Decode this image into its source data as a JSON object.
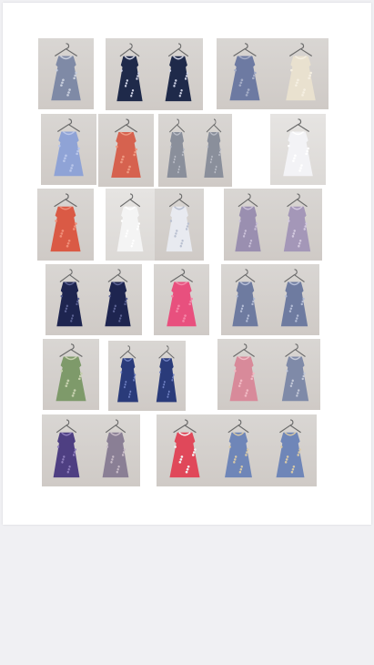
{
  "page": {
    "background": "#f0f0f3",
    "sheet_color": "#ffffff"
  },
  "photos": [
    {
      "name": "photo-gingham-dress",
      "colors": [
        "#7f8aa6",
        "#c9cfdd"
      ]
    },
    {
      "name": "photo-check-pinafore-dress-front",
      "colors": [
        "#1f2a4a",
        "#d0d4e6"
      ]
    },
    {
      "name": "photo-check-pinafore-dress-back",
      "colors": [
        "#1f2a4a",
        "#cfd3e6"
      ]
    },
    {
      "name": "photo-blue-pinafore",
      "colors": [
        "#6d7aa2",
        "#a4acc6"
      ]
    },
    {
      "name": "photo-cream-pinafore",
      "colors": [
        "#e9e1cf",
        "#f5efe2"
      ]
    },
    {
      "name": "photo-light-blue-dress",
      "colors": [
        "#8fa3d6",
        "#b9c6ea"
      ]
    },
    {
      "name": "photo-red-floral-dress",
      "colors": [
        "#d6624f",
        "#ee9a82"
      ]
    },
    {
      "name": "photo-floral-romper-front",
      "colors": [
        "#8a8f9b",
        "#b9bcc6"
      ]
    },
    {
      "name": "photo-floral-romper-back",
      "colors": [
        "#8a8f9b",
        "#b9bcc6"
      ]
    },
    {
      "name": "photo-white-dress",
      "colors": [
        "#f3f3f6",
        "#ffffff"
      ]
    },
    {
      "name": "photo-red-collar-dress",
      "colors": [
        "#da5a45",
        "#ef8e78"
      ]
    },
    {
      "name": "photo-white-eyelet-dress",
      "colors": [
        "#f4f4f4",
        "#ffffff"
      ]
    },
    {
      "name": "photo-white-print-dress",
      "colors": [
        "#e8eaf0",
        "#b8bfd0"
      ]
    },
    {
      "name": "photo-floral-blouse-front",
      "colors": [
        "#9a8fb0",
        "#c9bfd8"
      ]
    },
    {
      "name": "photo-floral-blouse-back",
      "colors": [
        "#a497b8",
        "#d3c9df"
      ]
    },
    {
      "name": "photo-navy-floral-dress-front",
      "colors": [
        "#1e2550",
        "#5b6294"
      ]
    },
    {
      "name": "photo-navy-floral-dress-back",
      "colors": [
        "#1e2550",
        "#5b6294"
      ]
    },
    {
      "name": "photo-pink-dress",
      "colors": [
        "#e8507e",
        "#f487a8"
      ]
    },
    {
      "name": "photo-check-shirt-front",
      "colors": [
        "#6e7ba0",
        "#b4bdd6"
      ]
    },
    {
      "name": "photo-check-shirt-back",
      "colors": [
        "#6e7ba0",
        "#b4bdd6"
      ]
    },
    {
      "name": "photo-green-floral-sundress",
      "colors": [
        "#7e9a6a",
        "#c6d0ae"
      ]
    },
    {
      "name": "photo-blue-collar-dress-front",
      "colors": [
        "#2a3b7a",
        "#6f80c2"
      ]
    },
    {
      "name": "photo-blue-collar-dress-back",
      "colors": [
        "#2a3b7a",
        "#6f80c2"
      ]
    },
    {
      "name": "photo-pink-check-dress",
      "colors": [
        "#d88a9a",
        "#f0b9c3"
      ]
    },
    {
      "name": "photo-floral-sundress-back",
      "colors": [
        "#7f8aa8",
        "#c4c9d8"
      ]
    },
    {
      "name": "photo-purple-floral-dress-front",
      "colors": [
        "#4e3f82",
        "#8f7fbd"
      ]
    },
    {
      "name": "photo-purple-floral-dress-back",
      "colors": [
        "#8a7f95",
        "#c8bcc8"
      ]
    },
    {
      "name": "photo-strawberry-dress",
      "colors": [
        "#e0485a",
        "#f2f2f2"
      ]
    },
    {
      "name": "photo-blue-tiered-sundress-front",
      "colors": [
        "#6f86b8",
        "#d8c9a6"
      ]
    },
    {
      "name": "photo-blue-tiered-sundress-back",
      "colors": [
        "#6f86b8",
        "#d8c9a6"
      ]
    }
  ]
}
